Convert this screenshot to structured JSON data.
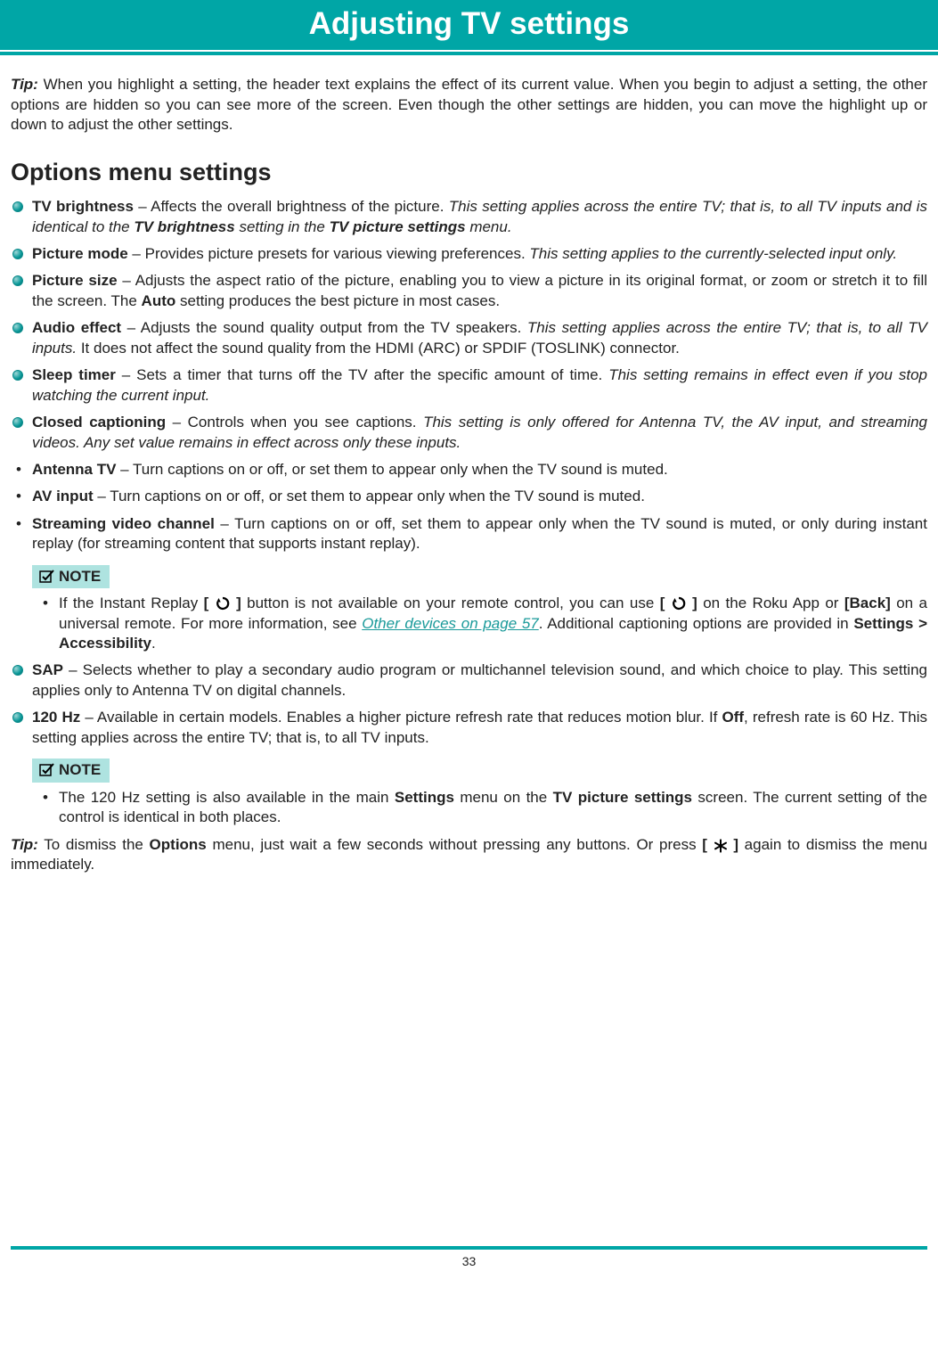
{
  "header": {
    "title": "Adjusting TV settings"
  },
  "tip1": {
    "label": "Tip:",
    "text": " When you highlight a setting, the header text explains the effect of its current value. When you begin to adjust a setting, the other options are hidden so you can see more of the screen. Even though the other settings are hidden, you can move the highlight up or down to adjust the other settings."
  },
  "section_title": "Options menu settings",
  "items": {
    "brightness": {
      "name": "TV brightness",
      "dash": " – Affects the overall brightness of the picture. ",
      "ital_a": "This setting applies across the entire TV; that is, to all TV inputs and is identical to the ",
      "bold_a": "TV brightness",
      "ital_b": " setting in the ",
      "bold_b": "TV picture settings",
      "ital_c": " menu."
    },
    "picmode": {
      "name": "Picture mode",
      "dash": " – Provides picture presets for various viewing preferences. ",
      "ital": "This setting applies to the currently-selected input only."
    },
    "picsize": {
      "name": "Picture size",
      "text": " – Adjusts the aspect ratio of the picture, enabling you to view a picture in its original format, or zoom or stretch it to fill the screen. The ",
      "bold": "Auto",
      "tail": " setting produces the best picture in most cases."
    },
    "audio": {
      "name": "Audio effect",
      "dash": " – Adjusts the sound quality output from the TV speakers. ",
      "ital": "This setting applies across the entire TV; that is, to all TV inputs.",
      "tail": " It does not affect the sound quality from the HDMI (ARC) or SPDIF (TOSLINK) connector."
    },
    "sleep": {
      "name": "Sleep timer",
      "dash": " – Sets a timer that turns off the TV after the specific amount of time. ",
      "ital": "This setting remains in effect even if you stop watching the current input."
    },
    "cc": {
      "name": "Closed captioning",
      "dash": " – Controls when you see captions. ",
      "ital": "This setting is only offered for Antenna TV, the AV input, and streaming videos. Any set value remains in effect across only these inputs."
    },
    "sap": {
      "name": "SAP",
      "text": " – Selects whether to play a secondary audio program or multichannel television sound, and which choice to play. This setting applies only to Antenna TV on digital channels."
    },
    "hz": {
      "name": "120 Hz",
      "text_a": " – Available in certain models. Enables a higher picture refresh rate that reduces motion blur. If ",
      "bold": "Off",
      "text_b": ", refresh rate is 60 Hz. This setting applies across the entire TV; that is, to all TV inputs."
    }
  },
  "sub": {
    "antenna": {
      "name": "Antenna TV",
      "text": " – Turn captions on or off, or set them to appear only when the TV sound is muted."
    },
    "av": {
      "name": "AV input",
      "text": " – Turn captions on or off, or set them to appear only when the TV sound is muted."
    },
    "stream": {
      "name": "Streaming video channel",
      "text": " – Turn captions on or off, set them to appear only when the TV sound is muted, or only during instant replay (for streaming content that supports instant replay)."
    }
  },
  "note_label": "NOTE",
  "note1": {
    "a": "If the Instant Replay ",
    "b": " button is not available on your remote control, you can use ",
    "c": " on the Roku App or ",
    "back": "[Back]",
    "d": " on a universal remote. For more information, see ",
    "link": "Other devices on page 57",
    "e": ". Additional captioning options are provided in ",
    "path": "Settings > Accessibility",
    "f": "."
  },
  "note2": {
    "a": "The 120 Hz setting is also available in the main ",
    "b1": "Settings",
    "b": " menu on the ",
    "b2": "TV picture settings",
    "c": " screen. The current setting of the control is identical in both places."
  },
  "tip2": {
    "label": "Tip:",
    "a": " To dismiss the ",
    "bold": "Options",
    "b": " menu, just wait a few seconds without pressing any buttons. Or press ",
    "c": " again to dismiss the menu immediately."
  },
  "bracket_open": "[ ",
  "bracket_close": " ]",
  "page_num": "33"
}
